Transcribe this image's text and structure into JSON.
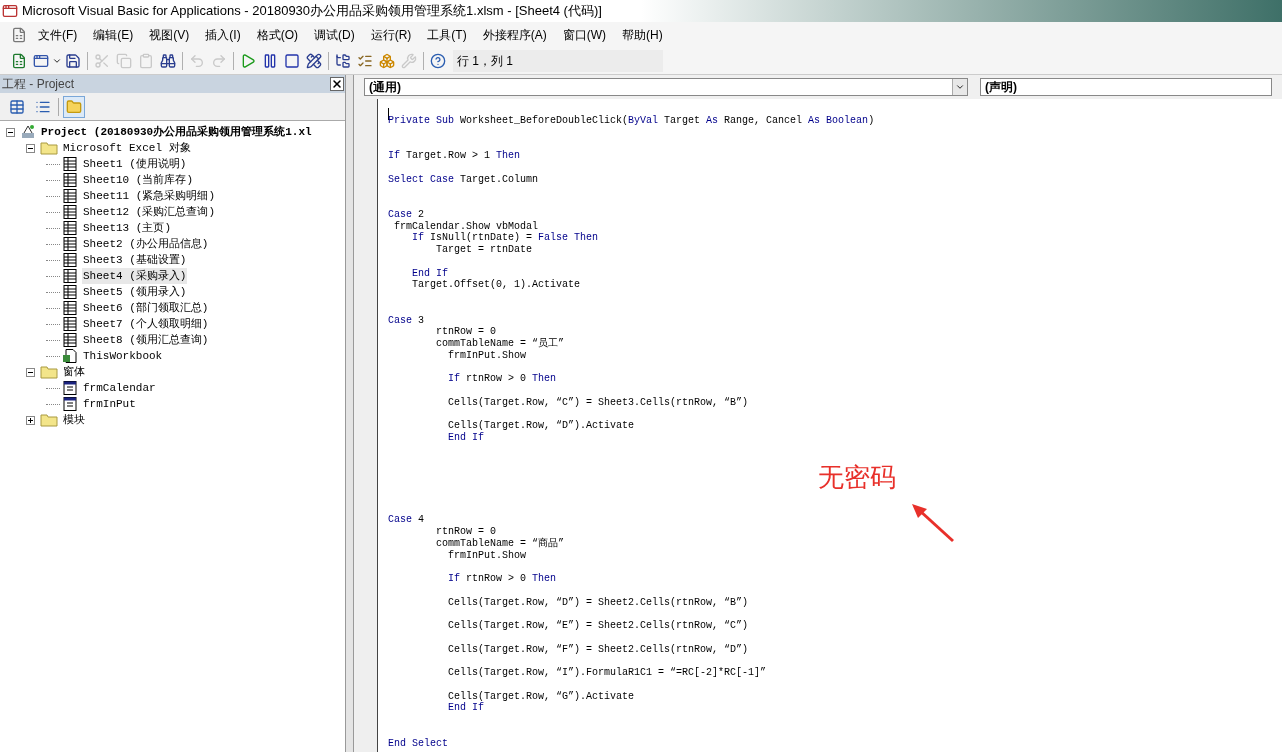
{
  "window": {
    "title": "Microsoft Visual Basic for Applications - 20180930办公用品采购领用管理系统1.xlsm - [Sheet4 (代码)]"
  },
  "menu": [
    "文件(F)",
    "编辑(E)",
    "视图(V)",
    "插入(I)",
    "格式(O)",
    "调试(D)",
    "运行(R)",
    "工具(T)",
    "外接程序(A)",
    "窗口(W)",
    "帮助(H)"
  ],
  "toolbar": {
    "position": "行 1，列 1"
  },
  "project_pane": {
    "title": "工程 - Project",
    "tree": [
      {
        "label": "Project (20180930办公用品采购领用管理系统1.xl",
        "kind": "project",
        "expanded": true,
        "selected": false,
        "children": [
          {
            "label": "Microsoft Excel 对象",
            "kind": "folder",
            "expanded": true,
            "selected": false,
            "children": [
              {
                "label": "Sheet1 (使用说明)",
                "kind": "sheet",
                "selected": false
              },
              {
                "label": "Sheet10 (当前库存)",
                "kind": "sheet",
                "selected": false
              },
              {
                "label": "Sheet11 (紧急采购明细)",
                "kind": "sheet",
                "selected": false
              },
              {
                "label": "Sheet12 (采购汇总查询)",
                "kind": "sheet",
                "selected": false
              },
              {
                "label": "Sheet13 (主页)",
                "kind": "sheet",
                "selected": false
              },
              {
                "label": "Sheet2 (办公用品信息)",
                "kind": "sheet",
                "selected": false
              },
              {
                "label": "Sheet3 (基础设置)",
                "kind": "sheet",
                "selected": false
              },
              {
                "label": "Sheet4 (采购录入)",
                "kind": "sheet",
                "selected": true
              },
              {
                "label": "Sheet5 (领用录入)",
                "kind": "sheet",
                "selected": false
              },
              {
                "label": "Sheet6 (部门领取汇总)",
                "kind": "sheet",
                "selected": false
              },
              {
                "label": "Sheet7 (个人领取明细)",
                "kind": "sheet",
                "selected": false
              },
              {
                "label": "Sheet8 (领用汇总查询)",
                "kind": "sheet",
                "selected": false
              },
              {
                "label": "ThisWorkbook",
                "kind": "workbook",
                "selected": false
              }
            ]
          },
          {
            "label": "窗体",
            "kind": "folder",
            "expanded": true,
            "selected": false,
            "children": [
              {
                "label": "frmCalendar",
                "kind": "form",
                "selected": false
              },
              {
                "label": "frmInPut",
                "kind": "form",
                "selected": false
              }
            ]
          },
          {
            "label": "模块",
            "kind": "folder",
            "expanded": false,
            "selected": false
          }
        ]
      }
    ]
  },
  "code_pane": {
    "object_dropdown": "(通用)",
    "procedure_dropdown": "(声明)",
    "lines": [
      {
        "kind": "cursor"
      },
      {
        "kind": "code",
        "tokens": [
          {
            "text": "Private Sub",
            "kind": "keyword"
          },
          {
            "text": " Worksheet_BeforeDoubleClick(",
            "kind": "plain"
          },
          {
            "text": "ByVal",
            "kind": "keyword"
          },
          {
            "text": " Target ",
            "kind": "plain"
          },
          {
            "text": "As",
            "kind": "keyword"
          },
          {
            "text": " Range, Cancel ",
            "kind": "plain"
          },
          {
            "text": "As Boolean",
            "kind": "keyword"
          },
          {
            "text": ")",
            "kind": "plain"
          }
        ]
      },
      {
        "kind": "blank"
      },
      {
        "kind": "blank"
      },
      {
        "kind": "code",
        "tokens": [
          {
            "text": "If",
            "kind": "keyword"
          },
          {
            "text": " Target.Row > 1 ",
            "kind": "plain"
          },
          {
            "text": "Then",
            "kind": "keyword"
          }
        ]
      },
      {
        "kind": "blank"
      },
      {
        "kind": "code",
        "tokens": [
          {
            "text": "Select Case",
            "kind": "keyword"
          },
          {
            "text": " Target.Column",
            "kind": "plain"
          }
        ]
      },
      {
        "kind": "blank"
      },
      {
        "kind": "blank"
      },
      {
        "kind": "code",
        "tokens": [
          {
            "text": "Case",
            "kind": "keyword"
          },
          {
            "text": " 2",
            "kind": "plain"
          }
        ]
      },
      {
        "kind": "code",
        "tokens": [
          {
            "text": " frmCalendar.Show vbModal",
            "kind": "plain"
          }
        ]
      },
      {
        "kind": "code",
        "tokens": [
          {
            "text": "    If",
            "kind": "keyword"
          },
          {
            "text": " IsNull(rtnDate) = ",
            "kind": "plain"
          },
          {
            "text": "False Then",
            "kind": "keyword"
          }
        ]
      },
      {
        "kind": "code",
        "tokens": [
          {
            "text": "        Target = rtnDate",
            "kind": "plain"
          }
        ]
      },
      {
        "kind": "blank"
      },
      {
        "kind": "code",
        "tokens": [
          {
            "text": "    End If",
            "kind": "keyword"
          }
        ]
      },
      {
        "kind": "code",
        "tokens": [
          {
            "text": "    Target.Offset(0, 1).Activate",
            "kind": "plain"
          }
        ]
      },
      {
        "kind": "blank"
      },
      {
        "kind": "blank"
      },
      {
        "kind": "code",
        "tokens": [
          {
            "text": "Case",
            "kind": "keyword"
          },
          {
            "text": " 3",
            "kind": "plain"
          }
        ]
      },
      {
        "kind": "code",
        "tokens": [
          {
            "text": "        rtnRow = 0",
            "kind": "plain"
          }
        ]
      },
      {
        "kind": "code",
        "tokens": [
          {
            "text": "        commTableName = “员工”",
            "kind": "plain"
          }
        ]
      },
      {
        "kind": "code",
        "tokens": [
          {
            "text": "          frmInPut.Show",
            "kind": "plain"
          }
        ]
      },
      {
        "kind": "blank"
      },
      {
        "kind": "code",
        "tokens": [
          {
            "text": "          If",
            "kind": "keyword"
          },
          {
            "text": " rtnRow > 0 ",
            "kind": "plain"
          },
          {
            "text": "Then",
            "kind": "keyword"
          }
        ]
      },
      {
        "kind": "blank"
      },
      {
        "kind": "code",
        "tokens": [
          {
            "text": "          Cells(Target.Row, “C”) = Sheet3.Cells(rtnRow, “B”)",
            "kind": "plain"
          }
        ]
      },
      {
        "kind": "blank"
      },
      {
        "kind": "code",
        "tokens": [
          {
            "text": "          Cells(Target.Row, “D”).Activate",
            "kind": "plain"
          }
        ]
      },
      {
        "kind": "code",
        "tokens": [
          {
            "text": "          End If",
            "kind": "keyword"
          }
        ]
      },
      {
        "kind": "blank"
      },
      {
        "kind": "blank"
      },
      {
        "kind": "blank"
      },
      {
        "kind": "blank"
      },
      {
        "kind": "blank"
      },
      {
        "kind": "blank"
      },
      {
        "kind": "code",
        "tokens": [
          {
            "text": "Case",
            "kind": "keyword"
          },
          {
            "text": " 4",
            "kind": "plain"
          }
        ]
      },
      {
        "kind": "code",
        "tokens": [
          {
            "text": "        rtnRow = 0",
            "kind": "plain"
          }
        ]
      },
      {
        "kind": "code",
        "tokens": [
          {
            "text": "        commTableName = “商品”",
            "kind": "plain"
          }
        ]
      },
      {
        "kind": "code",
        "tokens": [
          {
            "text": "          frmInPut.Show",
            "kind": "plain"
          }
        ]
      },
      {
        "kind": "blank"
      },
      {
        "kind": "code",
        "tokens": [
          {
            "text": "          If",
            "kind": "keyword"
          },
          {
            "text": " rtnRow > 0 ",
            "kind": "plain"
          },
          {
            "text": "Then",
            "kind": "keyword"
          }
        ]
      },
      {
        "kind": "blank"
      },
      {
        "kind": "code",
        "tokens": [
          {
            "text": "          Cells(Target.Row, “D”) = Sheet2.Cells(rtnRow, “B”)",
            "kind": "plain"
          }
        ]
      },
      {
        "kind": "blank"
      },
      {
        "kind": "code",
        "tokens": [
          {
            "text": "          Cells(Target.Row, “E”) = Sheet2.Cells(rtnRow, “C”)",
            "kind": "plain"
          }
        ]
      },
      {
        "kind": "blank"
      },
      {
        "kind": "code",
        "tokens": [
          {
            "text": "          Cells(Target.Row, “F”) = Sheet2.Cells(rtnRow, “D”)",
            "kind": "plain"
          }
        ]
      },
      {
        "kind": "blank"
      },
      {
        "kind": "code",
        "tokens": [
          {
            "text": "          Cells(Target.Row, “I”).FormulaR1C1 = “=RC[-2]*RC[-1]”",
            "kind": "plain"
          }
        ]
      },
      {
        "kind": "blank"
      },
      {
        "kind": "code",
        "tokens": [
          {
            "text": "          Cells(Target.Row, “G”).Activate",
            "kind": "plain"
          }
        ]
      },
      {
        "kind": "code",
        "tokens": [
          {
            "text": "          End If",
            "kind": "keyword"
          }
        ]
      },
      {
        "kind": "blank"
      },
      {
        "kind": "blank"
      },
      {
        "kind": "code",
        "tokens": [
          {
            "text": "End Select",
            "kind": "keyword"
          }
        ]
      }
    ]
  },
  "annotation": {
    "text": "无密码"
  }
}
